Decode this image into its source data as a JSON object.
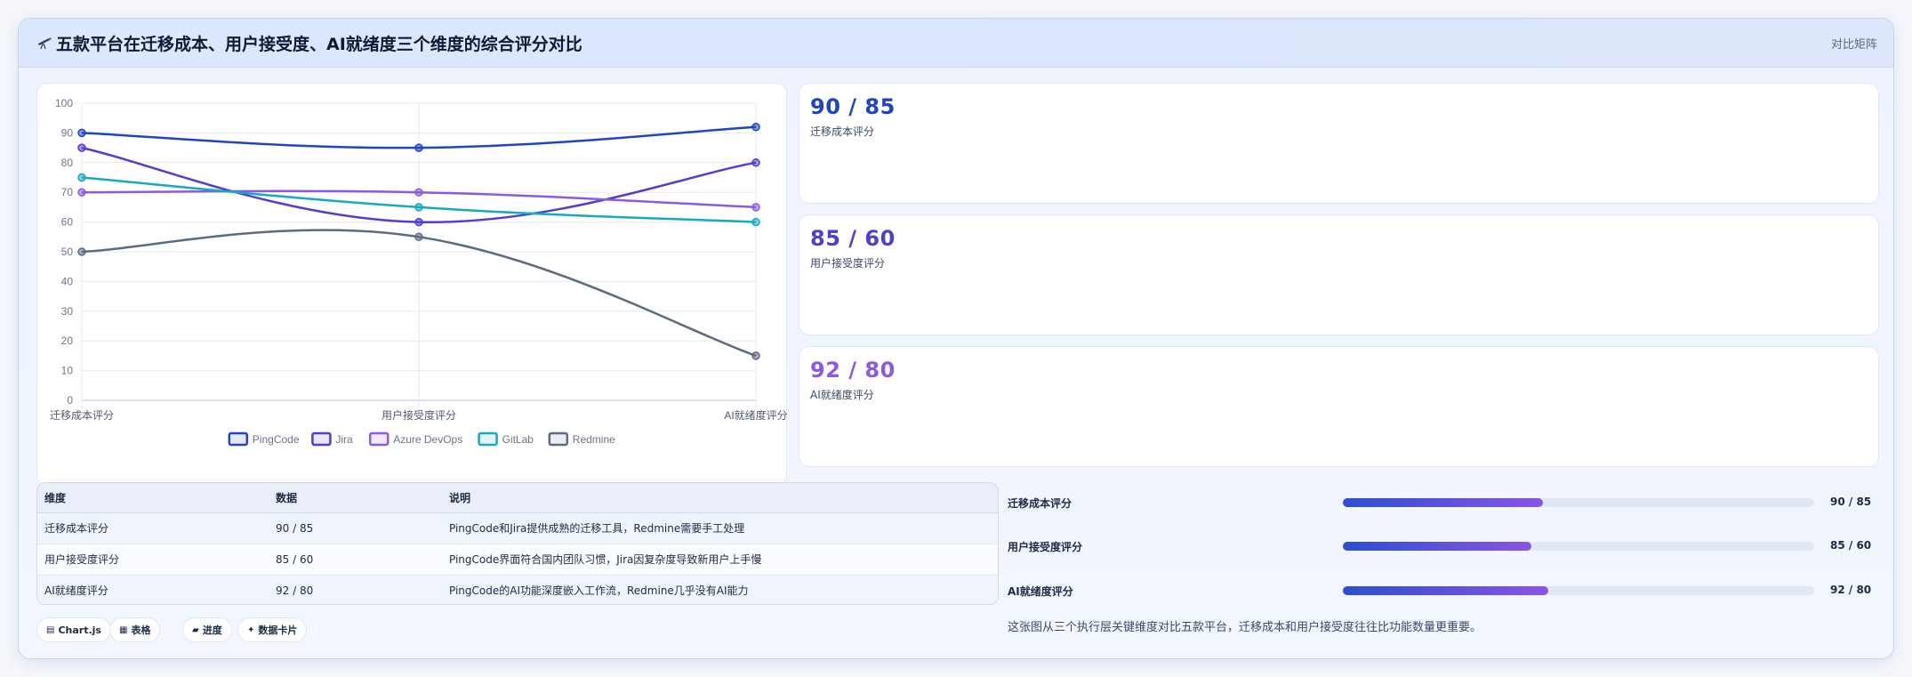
{
  "header": {
    "title": "五款平台在迁移成本、用户接受度、AI就绪度三个维度的综合评分对比",
    "badge": "对比矩阵",
    "icon": "telescope-icon"
  },
  "chart_data": {
    "type": "line",
    "categories": [
      "迁移成本评分",
      "用户接受度评分",
      "AI就绪度评分"
    ],
    "ylim": [
      0,
      100
    ],
    "yticks": [
      0,
      10,
      20,
      30,
      40,
      50,
      60,
      70,
      80,
      90,
      100
    ],
    "grid": true,
    "legend_position": "bottom",
    "series": [
      {
        "name": "PingCode",
        "values": [
          90,
          85,
          92
        ],
        "color": "#1f45c2"
      },
      {
        "name": "Jira",
        "values": [
          85,
          60,
          80
        ],
        "color": "#4f3fcf"
      },
      {
        "name": "Azure DevOps",
        "values": [
          70,
          70,
          65
        ],
        "color": "#8b5ae0"
      },
      {
        "name": "GitLab",
        "values": [
          75,
          65,
          60
        ],
        "color": "#15a9c4"
      },
      {
        "name": "Redmine",
        "values": [
          50,
          55,
          15
        ],
        "color": "#5d6b80"
      }
    ]
  },
  "kpis": [
    {
      "value": "90 / 85",
      "label": "迁移成本评分",
      "color": "#1f45c2"
    },
    {
      "value": "85 / 60",
      "label": "用户接受度评分",
      "color": "#4f3fcf"
    },
    {
      "value": "92 / 80",
      "label": "AI就绪度评分",
      "color": "#8b5ae0"
    }
  ],
  "table": {
    "headers": [
      "维度",
      "数据",
      "说明"
    ],
    "rows": [
      [
        "迁移成本评分",
        "90 / 85",
        "PingCode和Jira提供成熟的迁移工具，Redmine需要手工处理"
      ],
      [
        "用户接受度评分",
        "85 / 60",
        "PingCode界面符合国内团队习惯，Jira因复杂度导致新用户上手慢"
      ],
      [
        "AI就绪度评分",
        "92 / 80",
        "PingCode的AI功能深度嵌入工作流，Redmine几乎没有AI能力"
      ]
    ]
  },
  "progress": [
    {
      "label": "迁移成本评分",
      "value": "90 / 85",
      "fraction": 0.425
    },
    {
      "label": "用户接受度评分",
      "value": "85 / 60",
      "fraction": 0.4
    },
    {
      "label": "AI就绪度评分",
      "value": "92 / 80",
      "fraction": 0.435
    }
  ],
  "pills": [
    {
      "label": "Chart.js",
      "icon": "chart-icon"
    },
    {
      "label": "表格",
      "icon": "table-icon"
    },
    {
      "label": "进度",
      "icon": "progress-icon"
    },
    {
      "label": "数据卡片",
      "icon": "card-icon"
    }
  ],
  "footnote": "这张图从三个执行层关键维度对比五款平台，迁移成本和用户接受度往往比功能数量更重要。"
}
